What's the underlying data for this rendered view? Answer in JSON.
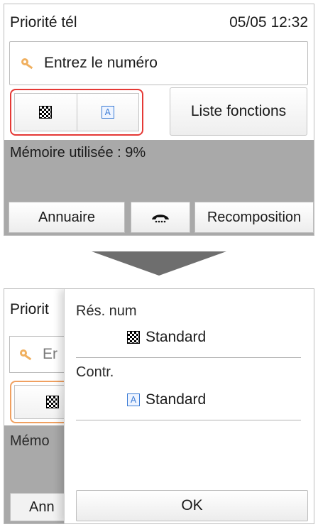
{
  "screen1": {
    "title": "Priorité tél",
    "datetime": "05/05 12:32",
    "input_placeholder": "Entrez le numéro",
    "resolution_icon": "checkerboard-icon",
    "contrast_icon": "contrast-a-icon",
    "contrast_icon_glyph": "A",
    "list_functions_label": "Liste fonctions",
    "memory_text": "Mémoire utilisée : 9%",
    "bottom_buttons": {
      "annuaire": "Annuaire",
      "hook_icon": "phone-hook-icon",
      "recomposition": "Recomposition"
    },
    "highlight_color": "#e53935"
  },
  "screen2": {
    "background": {
      "title_partial": "Priorit",
      "input_partial": "Er",
      "memory_partial": "Mémo",
      "annuaire_partial": "Ann"
    },
    "popup": {
      "resolution_label": "Rés. num",
      "resolution_value": "Standard",
      "contrast_label": "Contr.",
      "contrast_value": "Standard",
      "contrast_icon_glyph": "A",
      "ok_label": "OK"
    }
  }
}
